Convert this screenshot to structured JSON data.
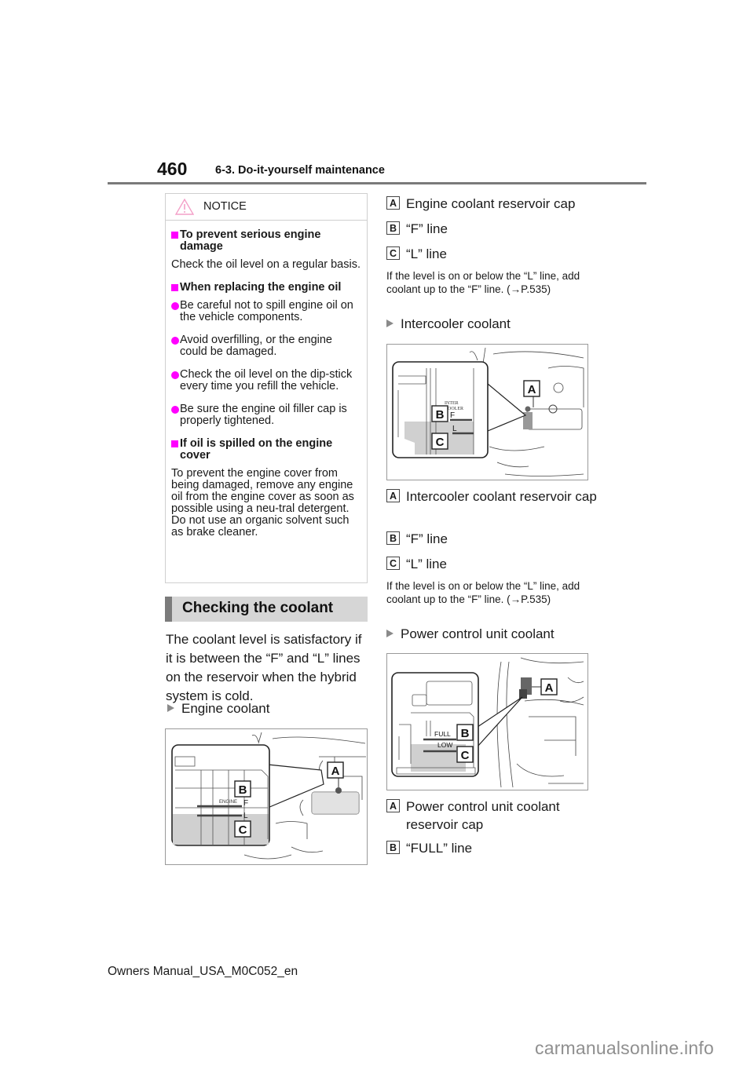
{
  "header": {
    "page_number": "460",
    "section": "6-3. Do-it-yourself maintenance"
  },
  "notice": {
    "icon": "warning-triangle-icon",
    "label": "NOTICE",
    "accent_color": "#ff00ff",
    "sections": [
      {
        "heading": "To prevent serious engine damage",
        "text": "Check the oil level on a regular basis."
      },
      {
        "heading": "When replacing the engine oil",
        "bullets": [
          "Be careful not to spill engine oil on the vehicle components.",
          "Avoid overfilling, or the engine could be damaged.",
          "Check the oil level on the dip-stick every time you refill the vehicle.",
          "Be sure the engine oil filler cap is properly tightened."
        ]
      },
      {
        "heading": "If oil is spilled on the engine cover",
        "text": "To prevent the engine cover from being damaged, remove any engine oil from the engine cover as soon as possible using a neu-tral detergent. Do not use an organic solvent such as brake cleaner."
      }
    ]
  },
  "coolant": {
    "title": "Checking the coolant",
    "intro": "The coolant level is satisfactory if it is between the “F” and “L” lines on the reservoir when the hybrid system is cold.",
    "engine": {
      "label": "Engine coolant",
      "figure": {
        "callouts": [
          "A",
          "B",
          "C"
        ],
        "marks": [
          "ENGINE",
          "F",
          "L"
        ]
      },
      "legend": [
        {
          "key": "A",
          "text": "Engine coolant reservoir cap"
        },
        {
          "key": "B",
          "text": "“F” line"
        },
        {
          "key": "C",
          "text": "“L” line"
        }
      ],
      "note": "If the level is on or below the “L” line, add coolant up to the “F” line. (→P.535)"
    },
    "intercooler": {
      "label": "Intercooler coolant",
      "figure": {
        "callouts": [
          "A",
          "B",
          "C"
        ],
        "marks": [
          "INTER",
          "COOLER",
          "F",
          "L"
        ]
      },
      "legend": [
        {
          "key": "A",
          "text": "Intercooler coolant reservoir cap"
        },
        {
          "key": "B",
          "text": "“F” line"
        },
        {
          "key": "C",
          "text": "“L” line"
        }
      ],
      "note": "If the level is on or below the “L” line, add coolant up to the “F” line. (→P.535)"
    },
    "pcu": {
      "label": "Power control unit coolant",
      "figure": {
        "callouts": [
          "A",
          "B",
          "C"
        ],
        "marks": [
          "FULL",
          "LOW"
        ]
      },
      "legend": [
        {
          "key": "A",
          "text": "Power control unit coolant reservoir cap"
        },
        {
          "key": "B",
          "text": "“FULL” line"
        }
      ]
    }
  },
  "footer": {
    "manual_id": "Owners Manual_USA_M0C052_en",
    "watermark": "carmanualsonline.info"
  }
}
